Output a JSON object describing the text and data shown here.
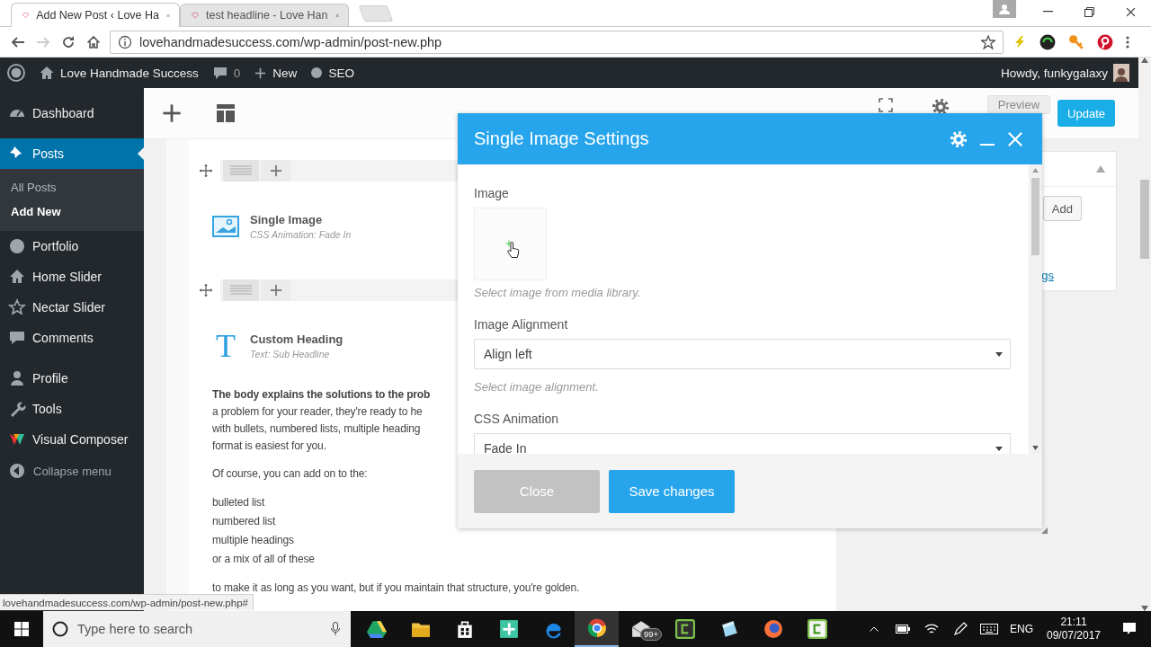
{
  "browser": {
    "tabs": [
      {
        "title": "Add New Post ‹ Love Ha",
        "selected": true
      },
      {
        "title": "test headline - Love Han",
        "selected": false
      }
    ],
    "address": "lovehandmadesuccess.com/wp-admin/post-new.php"
  },
  "admin_bar": {
    "site": "Love Handmade Success",
    "comments": "0",
    "new": "New",
    "seo": "SEO",
    "greeting": "Howdy, funkygalaxy"
  },
  "sidebar": {
    "groups": [
      {
        "items": [
          {
            "label": "Dashboard",
            "selected": false
          }
        ]
      },
      {
        "items": [
          {
            "label": "Posts",
            "selected": true,
            "children": [
              {
                "label": "All Posts",
                "selected": false
              },
              {
                "label": "Add New",
                "selected": true
              }
            ]
          },
          {
            "label": "Portfolio",
            "selected": false
          },
          {
            "label": "Home Slider",
            "selected": false
          },
          {
            "label": "Nectar Slider",
            "selected": false
          },
          {
            "label": "Comments",
            "selected": false
          }
        ]
      },
      {
        "items": [
          {
            "label": "Profile",
            "selected": false
          },
          {
            "label": "Tools",
            "selected": false
          },
          {
            "label": "Visual Composer",
            "selected": false
          }
        ]
      }
    ],
    "collapse": "Collapse menu"
  },
  "toolbar": {
    "buttons": [
      {
        "label": "Preview",
        "kind": "secondary"
      },
      {
        "label": "Update",
        "kind": "primary"
      }
    ]
  },
  "editor": {
    "elements": [
      {
        "kind": "image",
        "title": "Single Image",
        "subtitle": "CSS Animation: Fade In"
      },
      {
        "kind": "heading",
        "icon": "T",
        "title": "Custom Heading",
        "subtitle": "Text: Sub Headline"
      }
    ],
    "content": [
      {
        "kind": "paragraph",
        "lines": [
          {
            "text": "The body explains the solutions to the prob",
            "bold": true
          },
          {
            "text": "a problem for your reader, they're ready to he",
            "bold": false
          },
          {
            "text": "with bullets, numbered lists, multiple heading",
            "bold": false
          },
          {
            "text": "format is easiest for you.",
            "bold": false
          }
        ]
      },
      {
        "kind": "paragraph",
        "lines": [
          {
            "text": "Of course, you can add on to the:",
            "bold": false
          }
        ]
      },
      {
        "kind": "list",
        "lines": [
          {
            "text": "bulleted list",
            "bold": false
          },
          {
            "text": "numbered list",
            "bold": false
          },
          {
            "text": "multiple headings",
            "bold": false
          },
          {
            "text": "or a mix of all of these",
            "bold": false
          }
        ]
      },
      {
        "kind": "paragraph",
        "lines": [
          {
            "text": "to make it as long as you want, but if you maintain that structure, you're golden.",
            "bold": false
          }
        ]
      }
    ]
  },
  "side_panel": {
    "button": "Add",
    "link": "gs"
  },
  "dialog": {
    "title": "Single Image Settings",
    "fields": [
      {
        "kind": "image",
        "label": "Image",
        "hint": "Select image from media library."
      },
      {
        "kind": "select",
        "label": "Image Alignment",
        "value": "Align left",
        "hint": "Select image alignment."
      },
      {
        "kind": "select",
        "label": "CSS Animation",
        "value": "Fade In"
      }
    ],
    "buttons": [
      {
        "label": "Close",
        "kind": "secondary"
      },
      {
        "label": "Save changes",
        "kind": "primary"
      }
    ]
  },
  "status_url": "lovehandmadesuccess.com/wp-admin/post-new.php#",
  "taskbar": {
    "search_placeholder": "Type here to search",
    "badge": "99+",
    "language": "ENG",
    "time": "21:11",
    "date": "09/07/2017"
  }
}
